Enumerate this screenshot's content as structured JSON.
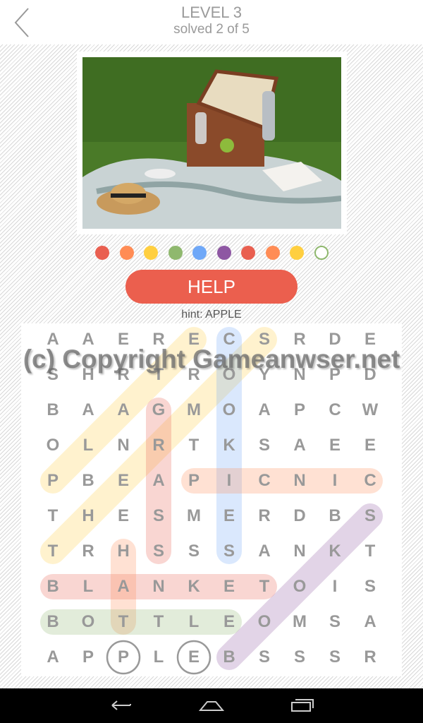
{
  "header": {
    "title": "LEVEL 3",
    "subtitle": "solved 2 of 5"
  },
  "progress_dots": [
    "#e95f50",
    "#ff8c55",
    "#ffcf40",
    "#8fb86e",
    "#6fa8f8",
    "#8e57a3",
    "#e95f50",
    "#ff8c55",
    "#ffcf40",
    "empty"
  ],
  "help_label": "HELP",
  "hint": "hint: APPLE",
  "watermark": "(c) Copyright Gameanwser.net",
  "grid": [
    "AAERECSRDE",
    "SHRTROYNPD",
    "BAAGMOAPCW",
    "OLNRTKSAEE",
    "PBEAPICNIC",
    "THESMERDBS",
    "TRHSSSANKT",
    "BLANKETOIS",
    "BOTTLEOMSA",
    "APPLEBSSSR"
  ],
  "found_words": [
    {
      "from": [
        4,
        0
      ],
      "to": [
        0,
        4
      ],
      "color": "#ffcf40"
    },
    {
      "from": [
        6,
        0
      ],
      "to": [
        0,
        6
      ],
      "color": "#ffcf40"
    },
    {
      "from": [
        2,
        3
      ],
      "to": [
        6,
        3
      ],
      "color": "#e95f50"
    },
    {
      "from": [
        0,
        5
      ],
      "to": [
        6,
        5
      ],
      "color": "#6fa8f8"
    },
    {
      "from": [
        4,
        4
      ],
      "to": [
        4,
        9
      ],
      "color": "#ff8c55"
    },
    {
      "from": [
        9,
        5
      ],
      "to": [
        5,
        9
      ],
      "color": "#8e57a3"
    },
    {
      "from": [
        7,
        0
      ],
      "to": [
        7,
        6
      ],
      "color": "#e95f50"
    },
    {
      "from": [
        6,
        2
      ],
      "to": [
        8,
        2
      ],
      "color": "#ff8c55"
    },
    {
      "from": [
        8,
        0
      ],
      "to": [
        8,
        5
      ],
      "color": "#8fb86e"
    }
  ],
  "hint_circles": [
    [
      9,
      2
    ],
    [
      9,
      4
    ]
  ]
}
